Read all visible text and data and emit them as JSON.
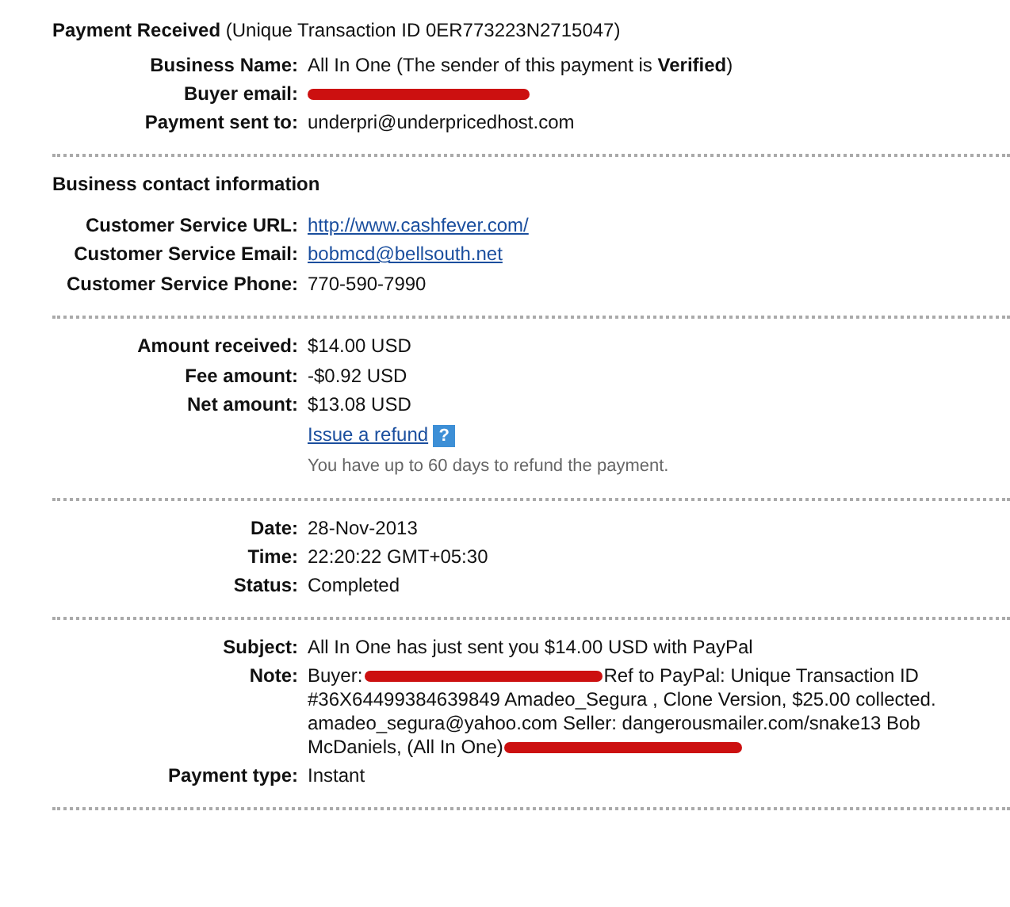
{
  "sections": [
    {
      "heading": "**Payment Received** (Unique Transaction ID 0ER773223N2715047)",
      "groups": [
        [
          {
            "label": "Business Name:",
            "kind": "text",
            "value": "All In One (The sender of this payment is **Verified**)"
          },
          {
            "label": "Buyer email:",
            "kind": "redacted"
          },
          {
            "label": "Payment sent to:",
            "kind": "text",
            "value": "underpri@underpricedhost.com"
          }
        ]
      ]
    },
    {
      "heading": "Business contact information",
      "groups": [
        [
          {
            "label": "Customer Service URL:",
            "kind": "link",
            "value": "http://www.cashfever.com/"
          },
          {
            "label": "Customer Service Email:",
            "kind": "link",
            "value": "bobmcd@bellsouth.net"
          }
        ],
        [
          {
            "label": "Customer Service Phone:",
            "kind": "text",
            "value": "770-590-7990"
          }
        ]
      ]
    },
    {
      "groups": [
        [
          {
            "label": "Amount received:",
            "kind": "text",
            "value": "$14.00 USD"
          }
        ],
        [
          {
            "label": "Fee amount:",
            "kind": "text",
            "value": "-$0.92 USD"
          },
          {
            "label": "Net amount:",
            "kind": "text",
            "value": "$13.08 USD"
          }
        ],
        [
          {
            "kind": "refund",
            "link": "Issue a refund",
            "help": "?",
            "hint": "You have up to 60 days to refund the payment."
          }
        ]
      ]
    },
    {
      "groups": [
        [
          {
            "label": "Date:",
            "kind": "text",
            "value": "28-Nov-2013"
          },
          {
            "label": "Time:",
            "kind": "text",
            "value": "22:20:22 GMT+05:30"
          },
          {
            "label": "Status:",
            "kind": "text",
            "value": "Completed"
          }
        ]
      ]
    },
    {
      "groups": [
        [
          {
            "label": "Subject:",
            "kind": "text",
            "value": "All In One has just sent you $14.00 USD with PayPal"
          },
          {
            "label": "Note:",
            "kind": "note",
            "parts": [
              {
                "kind": "text",
                "text": "Buyer:"
              },
              {
                "kind": "redacted"
              },
              {
                "kind": "text",
                "text": "Ref to PayPal: Unique Transaction ID #36X64499384639849 Amadeo_Segura , Clone Version, $25.00 collected. amadeo_segura@yahoo.com Seller: dangerousmailer.com/snake13 Bob McDaniels, (All In One)"
              },
              {
                "kind": "redacted"
              }
            ]
          },
          {
            "label": "Payment type:",
            "kind": "text",
            "value": "Instant"
          }
        ]
      ]
    }
  ]
}
